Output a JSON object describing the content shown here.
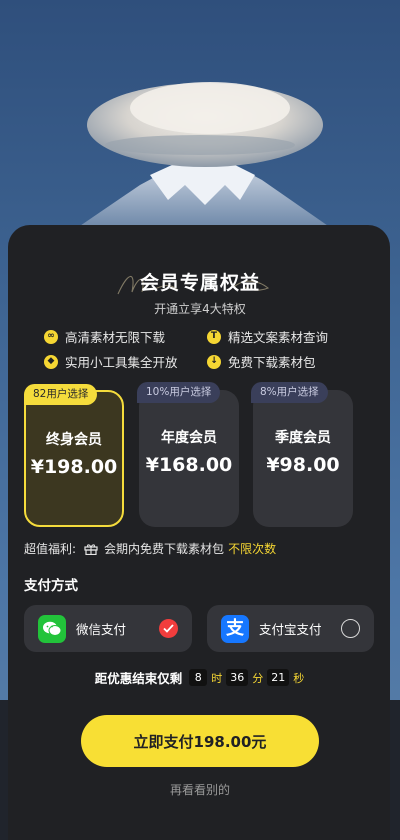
{
  "header": {
    "title": "会员专属权益",
    "subtitle": "开通立享4大特权"
  },
  "perks": [
    {
      "icon": "infinity-icon",
      "glyph": "∞",
      "label": "高清素材无限下载"
    },
    {
      "icon": "text-icon",
      "glyph": "T",
      "label": "精选文案素材查询"
    },
    {
      "icon": "compass-icon",
      "glyph": "◆",
      "label": "实用小工具集全开放"
    },
    {
      "icon": "download-icon",
      "glyph": "↓",
      "label": "免费下载素材包"
    }
  ],
  "plans": [
    {
      "tag": "82用户选择",
      "name": "终身会员",
      "price": "¥198.00",
      "selected": true
    },
    {
      "tag": "10%用户选择",
      "name": "年度会员",
      "price": "¥168.00",
      "selected": false
    },
    {
      "tag": "8%用户选择",
      "name": "季度会员",
      "price": "¥98.00",
      "selected": false
    }
  ],
  "bonus": {
    "label": "超值福利:",
    "text": "会期内免费下载素材包",
    "highlight": "不限次数"
  },
  "payment": {
    "title": "支付方式",
    "methods": [
      {
        "label": "微信支付",
        "selected": true
      },
      {
        "label": "支付宝支付",
        "selected": false
      }
    ]
  },
  "countdown": {
    "label": "距优惠结束仅剩",
    "hours": "8",
    "hours_unit": "时",
    "minutes": "36",
    "minutes_unit": "分",
    "seconds": "21",
    "seconds_unit": "秒"
  },
  "cta": {
    "pay_label": "立即支付198.00元",
    "later_label": "再看看别的"
  },
  "colors": {
    "accent": "#f8df34",
    "wechat": "#22c33a",
    "alipay": "#1677ff",
    "selected_check": "#f23d3d"
  }
}
